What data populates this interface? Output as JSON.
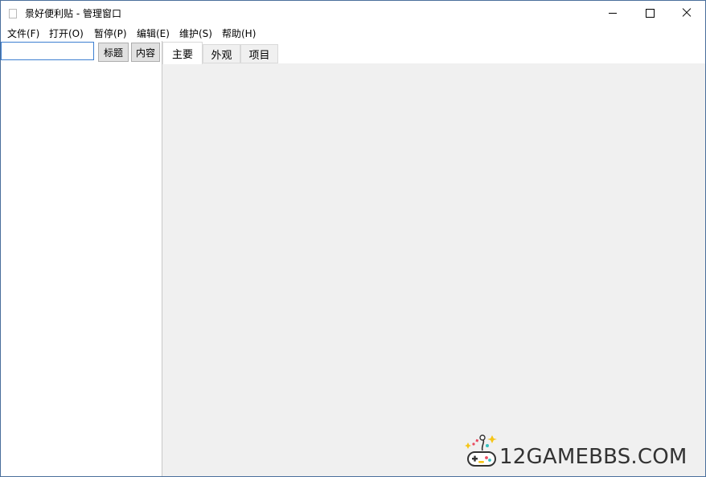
{
  "window": {
    "title": "景好便利贴 - 管理窗口"
  },
  "menu": {
    "file": "文件(F)",
    "open": "打开(O)",
    "pause": "暂停(P)",
    "edit": "编辑(E)",
    "maintain": "维护(S)",
    "help": "帮助(H)"
  },
  "search": {
    "value": "",
    "title_button": "标题",
    "content_button": "内容"
  },
  "tabs": {
    "main": "主要",
    "appearance": "外观",
    "project": "项目",
    "selected": "主要"
  },
  "watermark": {
    "text": "12GAMEBBS.COM",
    "icon": "gamepad-icon"
  },
  "colors": {
    "accent_border": "#3d7fd1",
    "panel_background": "#f0f0f0",
    "button_face": "#e1e1e1"
  }
}
